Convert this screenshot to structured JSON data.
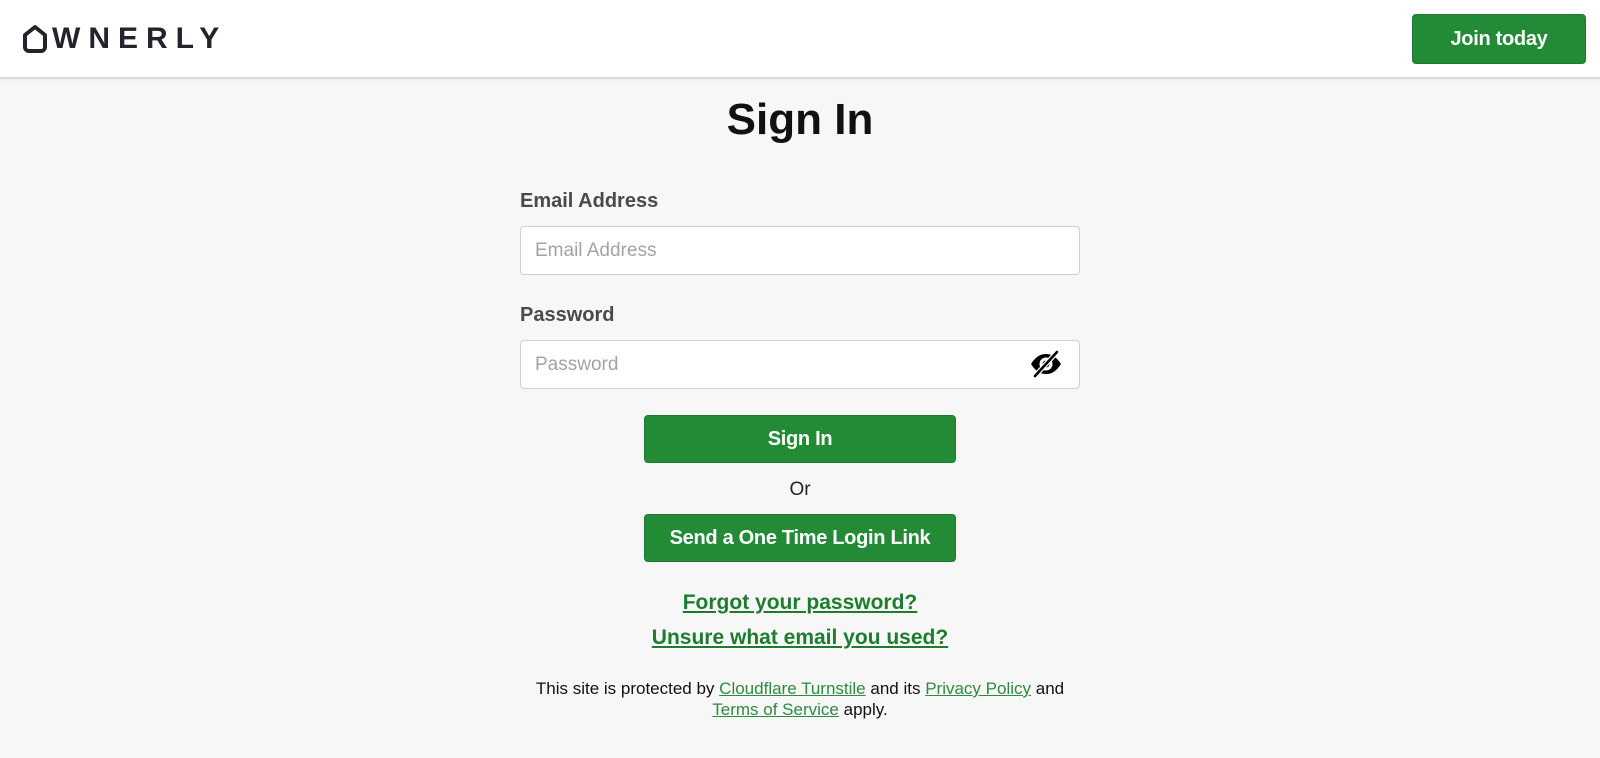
{
  "header": {
    "logo_text": "WNERLY",
    "join_label": "Join today"
  },
  "page": {
    "title": "Sign In"
  },
  "form": {
    "email_label": "Email Address",
    "email_placeholder": "Email Address",
    "email_value": "",
    "password_label": "Password",
    "password_placeholder": "Password",
    "password_value": "",
    "password_toggle_icon": "eye-slash-icon",
    "signin_label": "Sign In",
    "or_text": "Or",
    "otl_label": "Send a One Time Login Link",
    "forgot_label": "Forgot your password?",
    "unsure_label": "Unsure what email you used?"
  },
  "footer": {
    "prefix": "This site is protected by",
    "turnstile_link": "Cloudflare Turnstile",
    "middle": "and its",
    "privacy_link": "Privacy Policy",
    "and": "and",
    "terms_link": "Terms of Service",
    "suffix": "apply."
  },
  "colors": {
    "brand_green": "#238b35",
    "link_green": "#1e7c2f",
    "background": "#f7f7f7"
  }
}
